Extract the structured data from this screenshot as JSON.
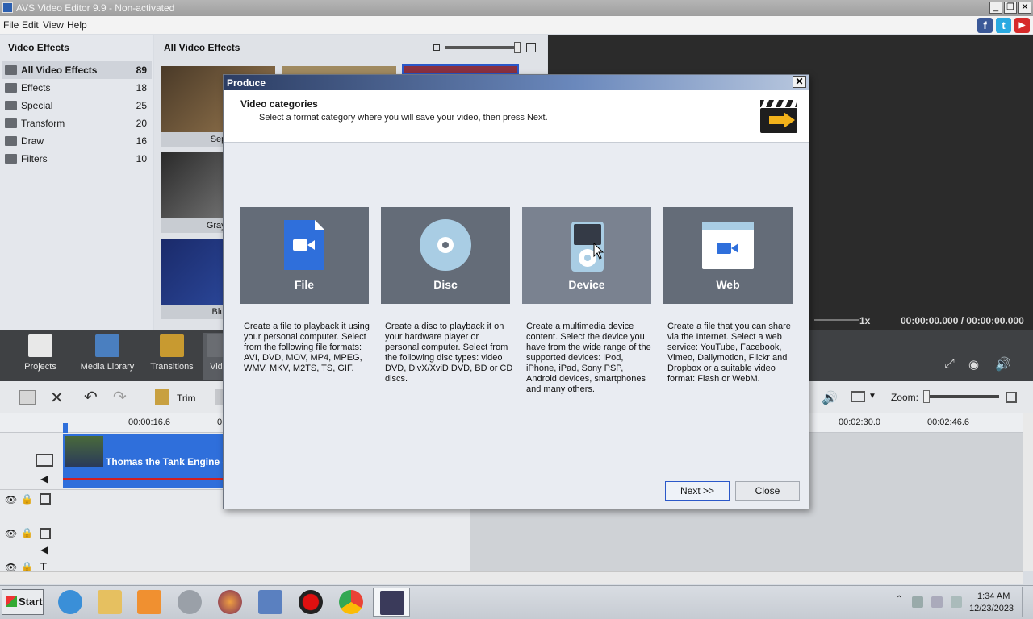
{
  "window": {
    "title": "AVS Video Editor 9.9 - Non-activated"
  },
  "menu": [
    "File",
    "Edit",
    "View",
    "Help"
  ],
  "social": [
    "f",
    "t",
    "▶"
  ],
  "effects_panel": {
    "title": "Video Effects",
    "categories": [
      {
        "label": "All Video Effects",
        "count": "89"
      },
      {
        "label": "Effects",
        "count": "18"
      },
      {
        "label": "Special",
        "count": "25"
      },
      {
        "label": "Transform",
        "count": "20"
      },
      {
        "label": "Draw",
        "count": "16"
      },
      {
        "label": "Filters",
        "count": "10"
      }
    ]
  },
  "effects_grid": {
    "title": "All Video Effects",
    "thumb_captions": [
      "Sep",
      "Grays",
      "Blu"
    ]
  },
  "preview": {
    "speed": "1x",
    "time": "00:00:00.000 / 00:00:00.000"
  },
  "tabs": [
    "Projects",
    "Media Library",
    "Transitions",
    "Vide"
  ],
  "timeline_toolbar": {
    "trim": "Trim",
    "zoom": "Zoom:"
  },
  "ruler": [
    "00:00:16.6",
    "0",
    "00:02:30.0",
    "00:02:46.6"
  ],
  "clip": {
    "title": "Thomas the Tank Engine -"
  },
  "dialog": {
    "title": "Produce",
    "heading": "Video categories",
    "subheading": "Select a format category where you will save your video, then press Next.",
    "categories": [
      {
        "name": "File",
        "description": "Create a file to playback it using your personal computer. Select from the following file formats: AVI, DVD, MOV, MP4, MPEG, WMV, MKV, M2TS, TS, GIF."
      },
      {
        "name": "Disc",
        "description": "Create a disc to playback it on your hardware player or personal computer. Select from the following disc types: video DVD, DivX/XviD DVD, BD or CD discs."
      },
      {
        "name": "Device",
        "description": "Create a multimedia device content. Select the device you have from the wide range of the supported devices: iPod, iPhone, iPad, Sony PSP, Android devices, smartphones and many others."
      },
      {
        "name": "Web",
        "description": "Create a file that you can share via the Internet. Select a web service: YouTube, Facebook, Vimeo, Dailymotion, Flickr and Dropbox or a suitable video format: Flash or WebM."
      }
    ],
    "next_label": "Next >>",
    "close_label": "Close"
  },
  "taskbar": {
    "start": "Start",
    "time": "1:34 AM",
    "date": "12/23/2023"
  },
  "colors": {
    "accent": "#2f6fdb",
    "dialog_title": "#2c3d63",
    "tile": "#646c78"
  }
}
